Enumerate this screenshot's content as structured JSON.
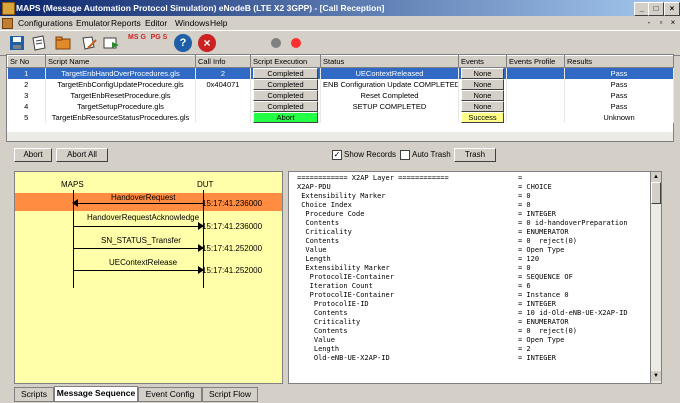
{
  "window": {
    "title": "MAPS (Message Automation Protocol Simulation) eNodeB (LTE X2 3GPP) - [Call Reception]",
    "min_label": "_",
    "max_label": "□",
    "close_label": "×"
  },
  "menu": {
    "items": [
      "Configurations",
      "Emulator",
      "Reports",
      "Editor",
      "Windows",
      "Help"
    ],
    "mdi_min": "-",
    "mdi_restore": "▫",
    "mdi_close": "×"
  },
  "toolbar": {
    "icons": [
      "save-icon",
      "open-icon",
      "folder-icon",
      "tools-icon",
      "run-icon",
      "msg-generator-icon",
      "pdu-generator-icon",
      "help-icon",
      "stop-icon",
      "status-gray-icon",
      "status-red-icon"
    ],
    "msg_label": "MS G",
    "pgs_label": "PG S",
    "help_label": "?",
    "stop_label": "×",
    "colors": {
      "blue": "#1f5fa8",
      "red": "#cc2222",
      "gray": "#808080",
      "status_red": "#ff3030"
    }
  },
  "grid": {
    "columns": [
      "Sr No",
      "Script Name",
      "Call Info",
      "Script Execution",
      "Status",
      "Events",
      "Events Profile",
      "Results"
    ],
    "rows": [
      {
        "sr": "1",
        "script": "TargetEnbHandOverProcedures.gls",
        "call": "2",
        "exec": "Completed",
        "status": "UEContextReleased",
        "events": "None",
        "profile": "",
        "result": "Pass"
      },
      {
        "sr": "2",
        "script": "TargetEnbConfigUpdateProcedure.gls",
        "call": "0x404071",
        "exec": "Completed",
        "status": "ENB Configuration Update COMPLETED",
        "events": "None",
        "profile": "",
        "result": "Pass"
      },
      {
        "sr": "3",
        "script": "TargetEnbResetProcedure.gls",
        "call": "",
        "exec": "Completed",
        "status": "Reset Completed",
        "events": "None",
        "profile": "",
        "result": "Pass"
      },
      {
        "sr": "4",
        "script": "TargetSetupProcedure.gls",
        "call": "",
        "exec": "Completed",
        "status": "SETUP COMPLETED",
        "events": "None",
        "profile": "",
        "result": "Pass"
      },
      {
        "sr": "5",
        "script": "TargetEnbResourceStatusProcedures.gls",
        "call": "",
        "exec": "Abort",
        "status": "",
        "events": "Success",
        "profile": "",
        "result": "Unknown"
      }
    ],
    "exec_abort_color": "#22ff44",
    "events_success_color": "#ffff88",
    "selected_color": "#316ac5"
  },
  "controls": {
    "abort": "Abort",
    "abort_all": "Abort All",
    "show_records": "Show Records",
    "show_records_checked": true,
    "auto_trash": "Auto Trash",
    "auto_trash_checked": false,
    "trash": "Trash",
    "check_mark": "✓"
  },
  "sequence": {
    "left_label": "MAPS",
    "right_label": "DUT",
    "messages": [
      {
        "name": "HandoverRequest",
        "time": "15:17:41.236000",
        "direction": "left",
        "highlight": true
      },
      {
        "name": "HandoverRequestAcknowledge",
        "time": "15:17:41.236000",
        "direction": "right",
        "highlight": false
      },
      {
        "name": "SN_STATUS_Transfer",
        "time": "15:17:41.252000",
        "direction": "right",
        "highlight": false
      },
      {
        "name": "UEContextRelease",
        "time": "15:17:41.252000",
        "direction": "right",
        "highlight": false
      }
    ],
    "background": "#ffffaa",
    "highlight_color": "#ff8c40"
  },
  "decode": {
    "lines": [
      {
        "k": "============ X2AP Layer ============",
        "v": "="
      },
      {
        "k": "X2AP-PDU",
        "v": "= CHOICE"
      },
      {
        "k": " Extensibility Marker",
        "v": "= 0"
      },
      {
        "k": " Choice Index",
        "v": "= 0"
      },
      {
        "k": "  Procedure Code",
        "v": "= INTEGER"
      },
      {
        "k": "  Contents",
        "v": "= 0 id-handoverPreparation"
      },
      {
        "k": "  Criticality",
        "v": "= ENUMERATOR"
      },
      {
        "k": "  Contents",
        "v": "= 0  reject(0)"
      },
      {
        "k": "  Value",
        "v": "= Open Type"
      },
      {
        "k": "  Length",
        "v": "= 120"
      },
      {
        "k": "  Extensibility Marker",
        "v": "= 0"
      },
      {
        "k": "   ProtocolIE-Container",
        "v": "= SEQUENCE OF"
      },
      {
        "k": "   Iteration Count",
        "v": "= 6"
      },
      {
        "k": "   ProtocolIE-Container",
        "v": "= Instance 0"
      },
      {
        "k": "    ProtocolIE-ID",
        "v": "= INTEGER"
      },
      {
        "k": "    Contents",
        "v": "= 10 id-Old-eNB-UE-X2AP-ID"
      },
      {
        "k": "    Criticality",
        "v": "= ENUMERATOR"
      },
      {
        "k": "    Contents",
        "v": "= 0  reject(0)"
      },
      {
        "k": "    Value",
        "v": "= Open Type"
      },
      {
        "k": "    Length",
        "v": "= 2"
      },
      {
        "k": "    Old-eNB-UE-X2AP-ID",
        "v": "= INTEGER"
      }
    ],
    "scroll_up": "▲",
    "scroll_down": "▼"
  },
  "tabs": [
    "Scripts",
    "Message Sequence",
    "Event Config",
    "Script Flow"
  ],
  "active_tab": "Message Sequence"
}
